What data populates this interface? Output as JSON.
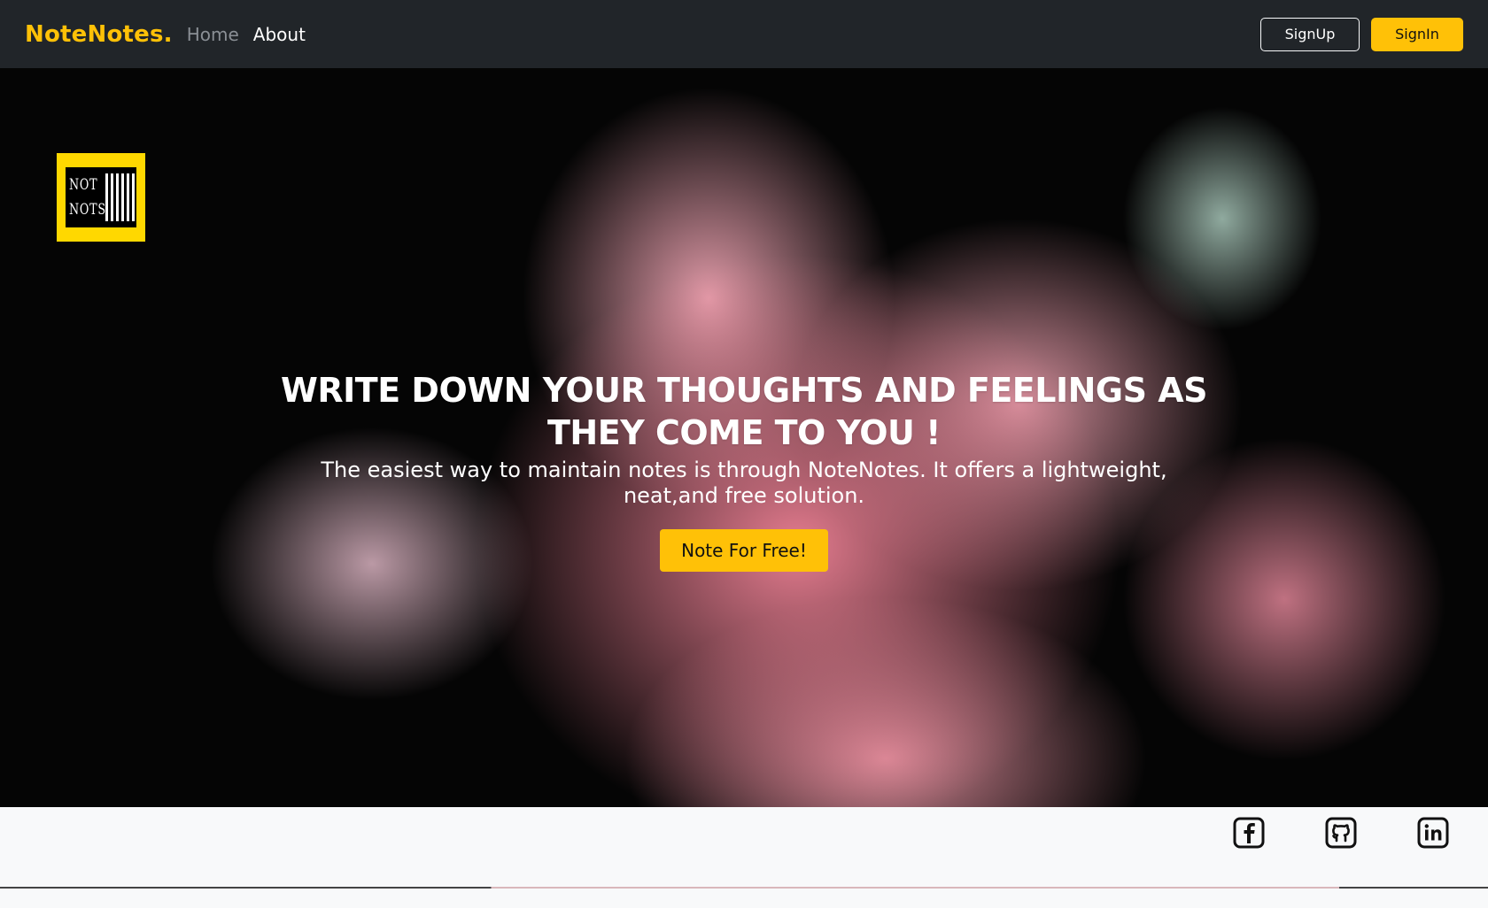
{
  "navbar": {
    "brand": "NoteNotes.",
    "links": [
      {
        "label": "Home"
      },
      {
        "label": "About"
      }
    ],
    "signup_label": "SignUp",
    "signin_label": "SignIn"
  },
  "hero": {
    "logo": {
      "lines": [
        "NOT",
        "NOTS"
      ],
      "bar_count": 6
    },
    "title_line1": "WRITE DOWN YOUR THOUGHTS AND FEELINGS AS",
    "title_line2": "THEY COME TO YOU !",
    "subtitle": "The easiest way to maintain notes is through NoteNotes. It offers a lightweight, neat,and free solution.",
    "cta_label": "Note For Free!"
  },
  "footer": {
    "social": [
      {
        "icon": "facebook-icon"
      },
      {
        "icon": "github-icon"
      },
      {
        "icon": "linkedin-icon"
      }
    ]
  },
  "colors": {
    "accent": "#ffc107",
    "navbar_bg": "#212529",
    "footer_bg": "#f8f9fa"
  }
}
